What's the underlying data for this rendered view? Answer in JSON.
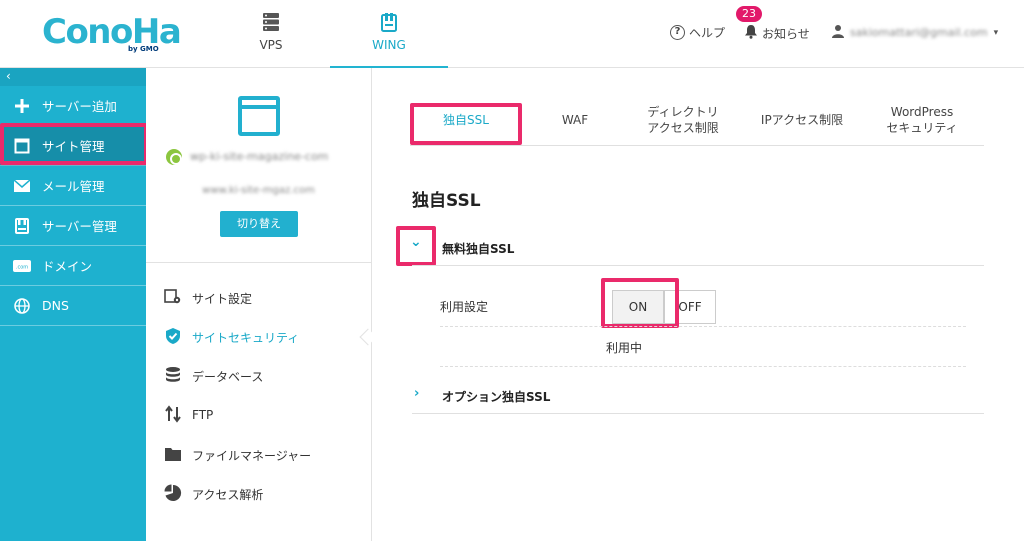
{
  "header": {
    "logo_main": "ConoHa",
    "logo_sub": "by GMO",
    "nav": [
      {
        "label": "VPS"
      },
      {
        "label": "WING"
      }
    ],
    "help_label": "ヘルプ",
    "notice_label": "お知らせ",
    "notice_count": "23",
    "user_email": "sakiomattari@gmail.com"
  },
  "sidebar": {
    "back_glyph": "‹",
    "items": [
      {
        "label": "サーバー追加",
        "icon": "plus-icon"
      },
      {
        "label": "サイト管理",
        "icon": "window-icon"
      },
      {
        "label": "メール管理",
        "icon": "mail-icon"
      },
      {
        "label": "サーバー管理",
        "icon": "server-icon"
      },
      {
        "label": "ドメイン",
        "icon": "domain-icon"
      },
      {
        "label": "DNS",
        "icon": "globe-icon"
      }
    ]
  },
  "site_panel": {
    "domain": "wp-ki-site-magazine-com",
    "sub": "www.ki-site-mgaz.com",
    "switch_label": "切り替え",
    "menu": [
      {
        "label": "サイト設定",
        "icon": "site-settings-icon"
      },
      {
        "label": "サイトセキュリティ",
        "icon": "shield-check-icon"
      },
      {
        "label": "データベース",
        "icon": "database-icon"
      },
      {
        "label": "FTP",
        "icon": "transfer-icon"
      },
      {
        "label": "ファイルマネージャー",
        "icon": "folder-icon"
      },
      {
        "label": "アクセス解析",
        "icon": "pie-chart-icon"
      }
    ]
  },
  "content": {
    "tabs": [
      {
        "line1": "独自SSL",
        "line2": ""
      },
      {
        "line1": "WAF",
        "line2": ""
      },
      {
        "line1": "ディレクトリ",
        "line2": "アクセス制限"
      },
      {
        "line1": "IPアクセス制限",
        "line2": ""
      },
      {
        "line1": "WordPress",
        "line2": "セキュリティ"
      }
    ],
    "title": "独自SSL",
    "free_ssl_title": "無料独自SSL",
    "use_setting_label": "利用設定",
    "on_label": "ON",
    "off_label": "OFF",
    "status_text": "利用中",
    "option_ssl_title": "オプション独自SSL"
  }
}
